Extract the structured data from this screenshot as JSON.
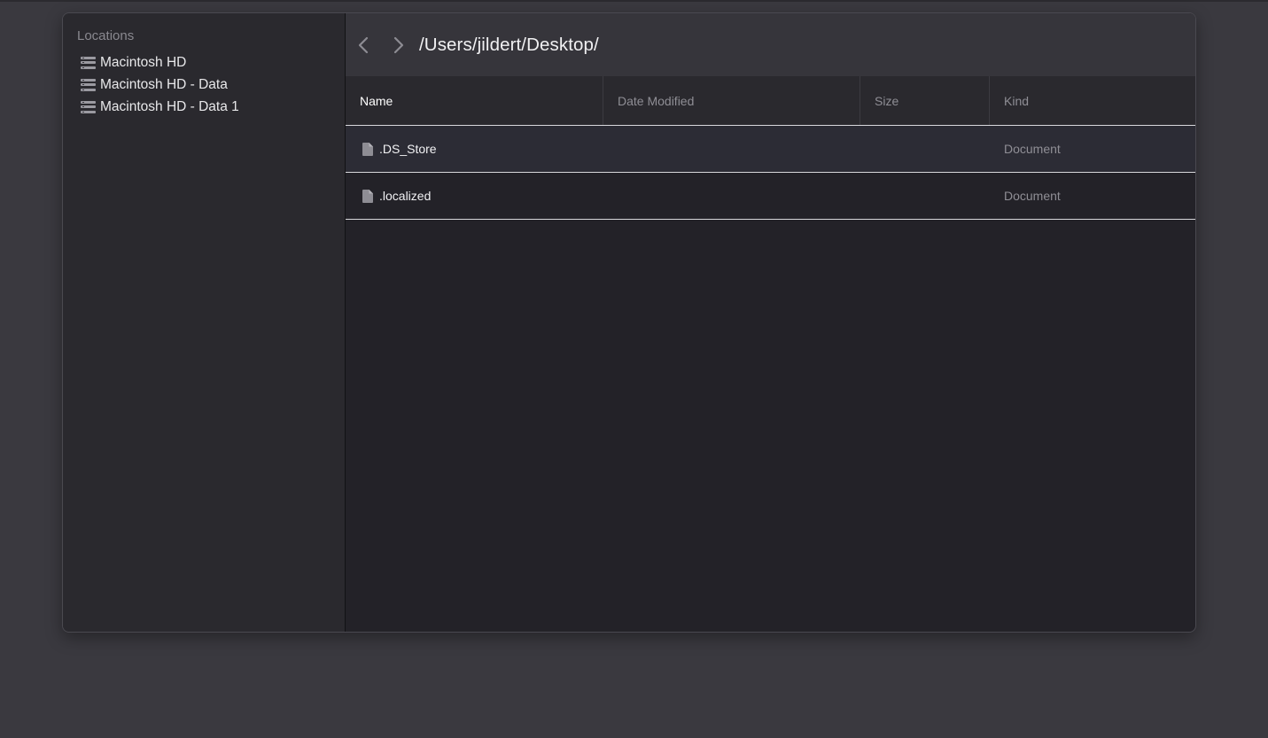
{
  "sidebar": {
    "header": "Locations",
    "items": [
      {
        "label": "Macintosh HD",
        "icon": "drive-icon"
      },
      {
        "label": "Macintosh HD - Data",
        "icon": "drive-icon"
      },
      {
        "label": "Macintosh HD - Data 1",
        "icon": "drive-icon"
      }
    ]
  },
  "toolbar": {
    "back_icon": "chevron-left-icon",
    "forward_icon": "chevron-right-icon",
    "path": "/Users/jildert/Desktop/"
  },
  "table": {
    "columns": [
      "Name",
      "Date Modified",
      "Size",
      "Kind"
    ],
    "rows": [
      {
        "name": ".DS_Store",
        "date_modified": "",
        "size": "",
        "kind": "Document",
        "icon": "document-icon",
        "selected": true
      },
      {
        "name": ".localized",
        "date_modified": "",
        "size": "",
        "kind": "Document",
        "icon": "document-icon",
        "selected": false
      }
    ]
  },
  "colors": {
    "background": "#3a393f",
    "sidebar": "#2a292e",
    "main": "#232228",
    "toolbar": "#36353b",
    "selected_row": "#2c2c35",
    "row_divider": "#d8d8dc"
  }
}
